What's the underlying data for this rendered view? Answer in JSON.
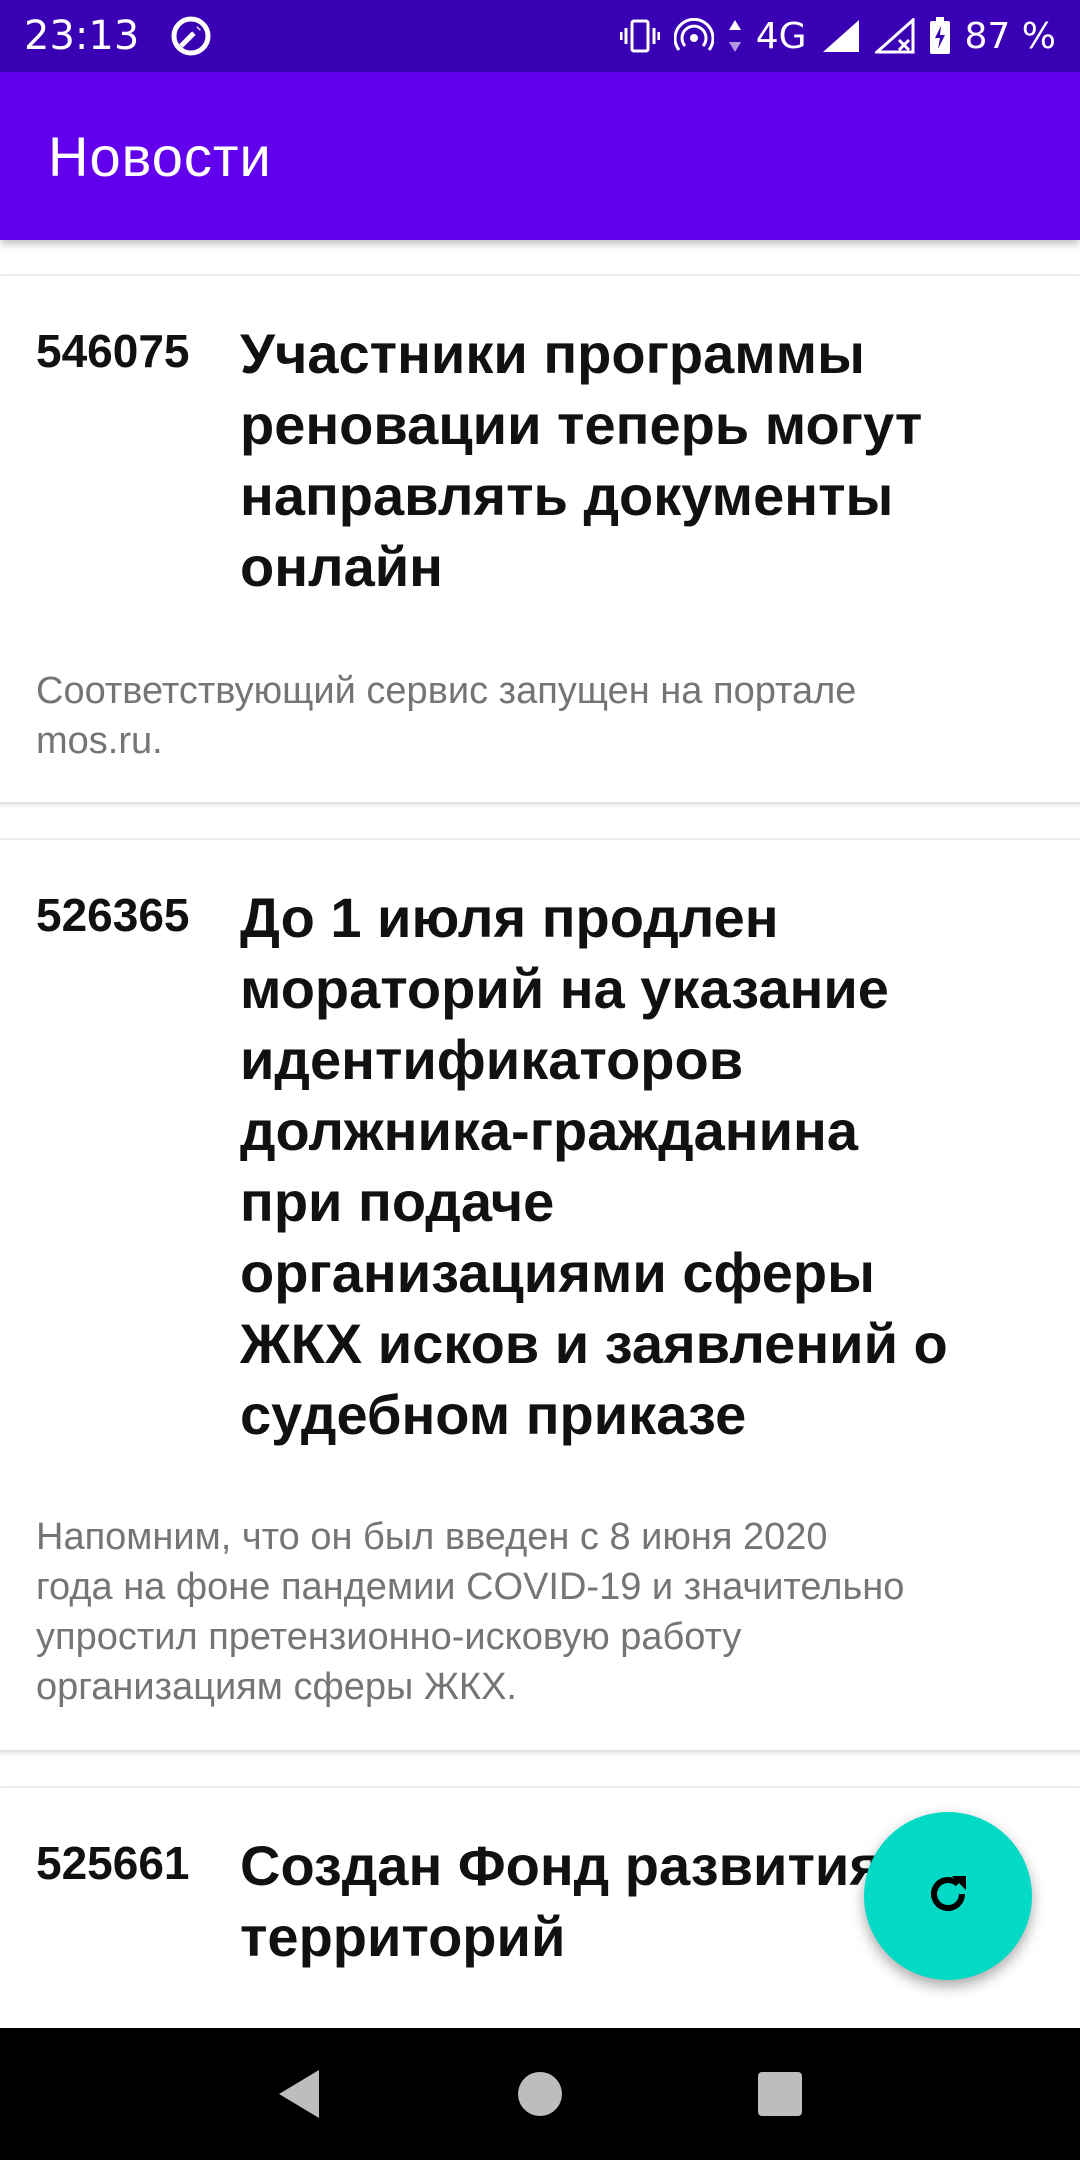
{
  "status_bar": {
    "time": "23:13",
    "network": "4G",
    "battery": "87 %"
  },
  "app_bar": {
    "title": "Новости"
  },
  "news": [
    {
      "id": "546075",
      "title_lines": [
        "Участники программы",
        "реновации теперь могут",
        "направлять документы",
        "онлайн"
      ],
      "desc_lines": [
        "Соответствующий сервис запущен на портале",
        "mos.ru."
      ]
    },
    {
      "id": "526365",
      "title_lines": [
        "До 1 июля продлен",
        "мораторий на указание",
        "идентификаторов",
        "должника-гражданина",
        "при подаче",
        "организациями сферы",
        "ЖКХ исков и заявлений о",
        "судебном приказе"
      ],
      "desc_lines": [
        "Напомним, что он был введен с 8 июня 2020",
        "года на фоне пандемии COVID-19 и значительно",
        "упростил претензионно-исковую работу",
        "организациям сферы ЖКХ."
      ]
    },
    {
      "id": "525661",
      "title_lines": [
        "Создан Фонд развития",
        "территорий"
      ],
      "desc_lines": []
    }
  ],
  "fab": {
    "icon": "refresh-icon"
  },
  "colors": {
    "status_bar": "#3a00b3",
    "app_bar": "#6200ee",
    "fab": "#03dac5",
    "nav_bar": "#000000"
  }
}
